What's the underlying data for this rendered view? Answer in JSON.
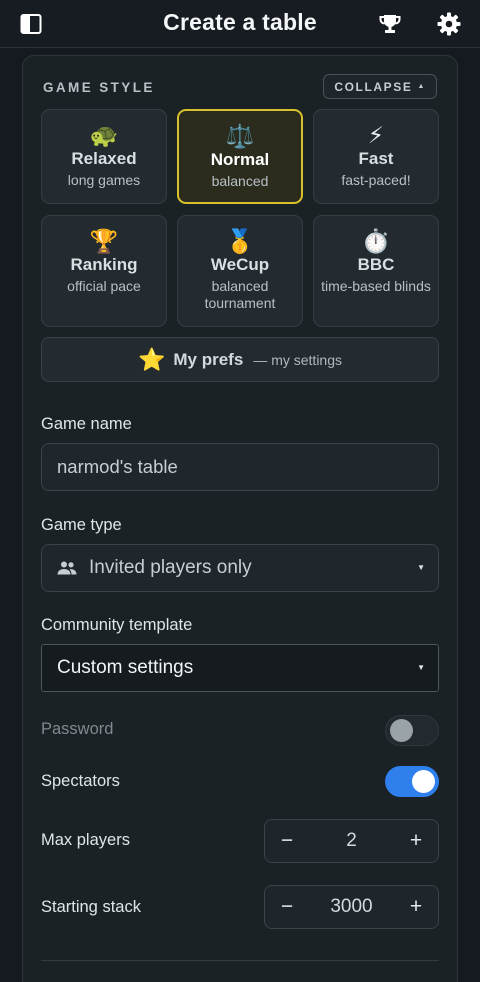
{
  "header": {
    "title": "Create a table"
  },
  "game_style": {
    "label": "GAME STYLE",
    "collapse_label": "COLLAPSE",
    "collapse_caret": "▲",
    "cards": [
      {
        "emoji": "🐢",
        "name": "Relaxed",
        "sub": "long games"
      },
      {
        "emoji": "⚖️",
        "name": "Normal",
        "sub": "balanced"
      },
      {
        "emoji": "⚡",
        "name": "Fast",
        "sub": "fast-paced!"
      },
      {
        "emoji": "🏆",
        "name": "Ranking",
        "sub": "official pace"
      },
      {
        "emoji": "🥇",
        "name": "WeCup",
        "sub": "balanced tournament"
      },
      {
        "emoji": "⏱️",
        "name": "BBC",
        "sub": "time-based blinds"
      }
    ],
    "selected": "Normal",
    "prefs": {
      "emoji": "⭐",
      "name": "My prefs",
      "desc": "— my settings"
    }
  },
  "form": {
    "game_name": {
      "label": "Game name",
      "value": "narmod's table"
    },
    "game_type": {
      "label": "Game type",
      "value": "Invited players only",
      "arrow": "▼"
    },
    "community_template": {
      "label": "Community template",
      "value": "Custom settings",
      "arrow": "▼"
    },
    "password": {
      "label": "Password",
      "enabled": false
    },
    "spectators": {
      "label": "Spectators",
      "enabled": true
    },
    "max_players": {
      "label": "Max players",
      "value": "2",
      "minus": "−",
      "plus": "+"
    },
    "starting_stack": {
      "label": "Starting stack",
      "value": "3000",
      "minus": "−",
      "plus": "+"
    }
  },
  "colors": {
    "accent_selected": "#d8c12c",
    "toggle_on": "#2f80ed",
    "background": "#141a1f"
  },
  "icons": {
    "left": "sidebar-toggle-icon",
    "trophy": "trophy-icon",
    "settings": "gear-icon",
    "people": "people-icon"
  }
}
